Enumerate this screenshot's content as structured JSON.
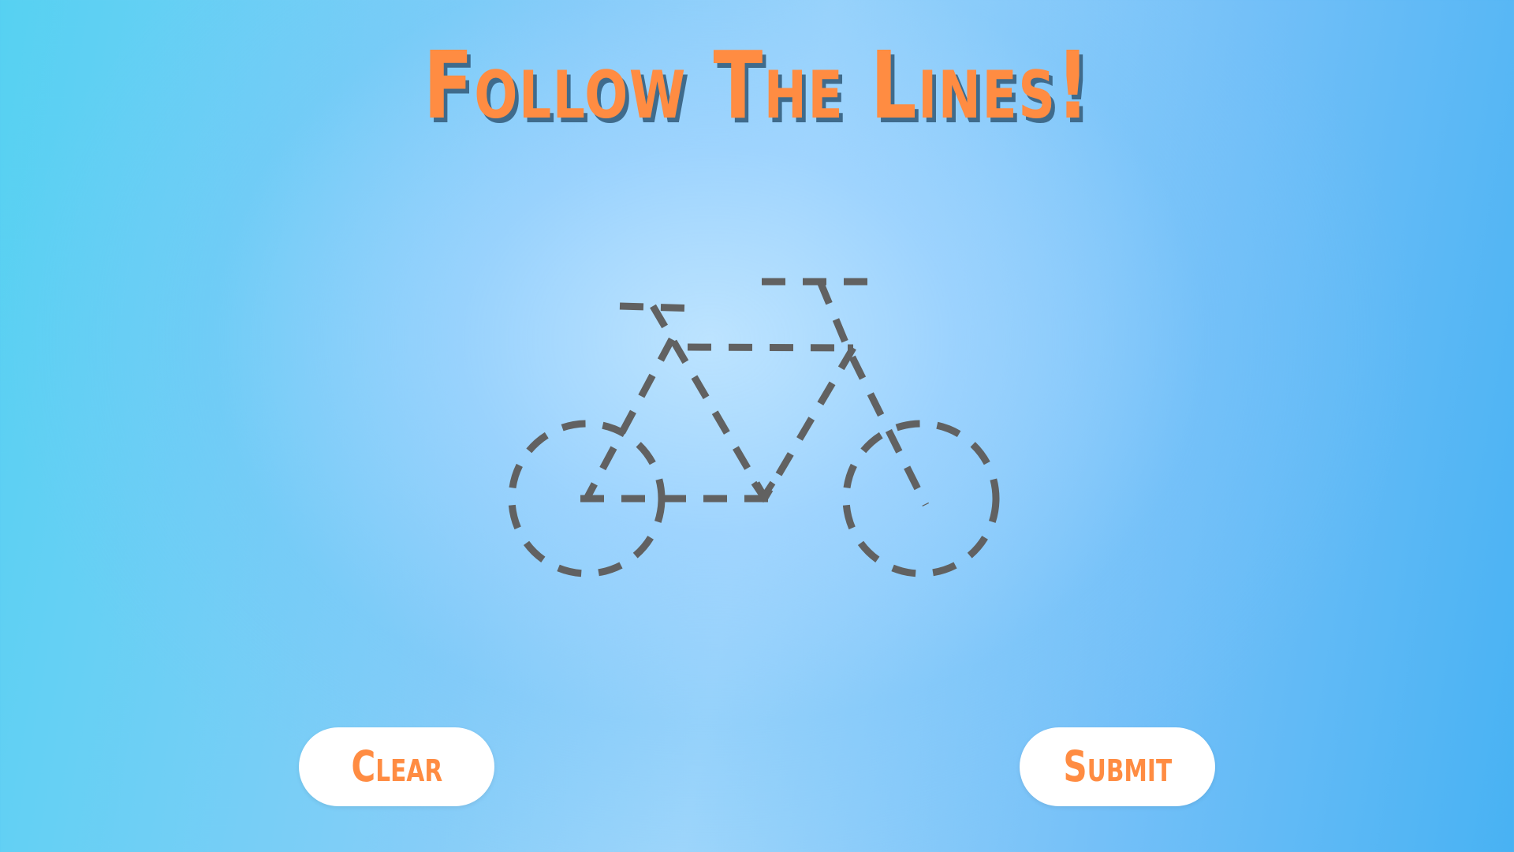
{
  "title": "Follow The Lines!",
  "buttons": {
    "clear_label": "Clear",
    "submit_label": "Submit"
  },
  "colors": {
    "title": "#ff8c42",
    "title_shadow": "#3f6b8c",
    "button_bg": "#ffffff",
    "button_text": "#ff8c42",
    "trace_line": "#616161"
  },
  "drawing": {
    "subject": "bicycle",
    "style": "dashed-outline"
  }
}
